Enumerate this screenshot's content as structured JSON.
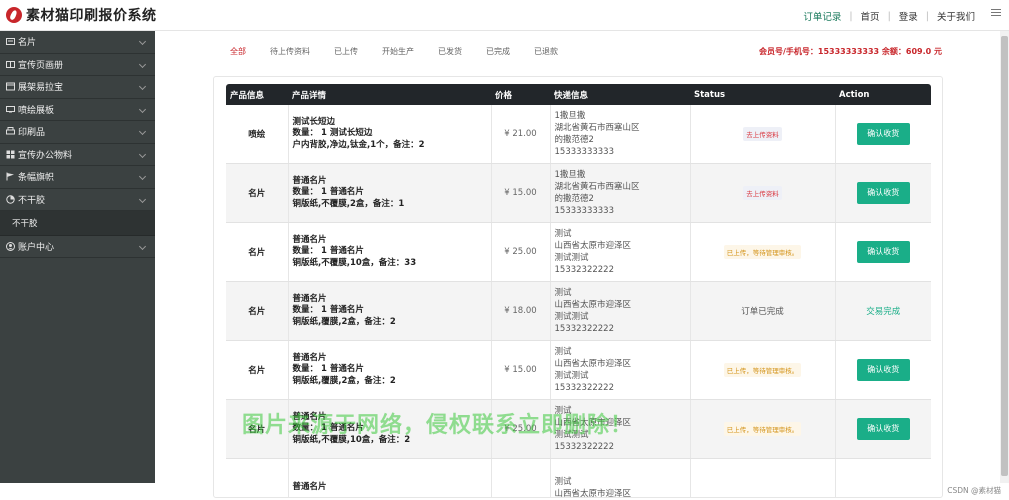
{
  "header": {
    "logo_text": "素材猫印刷报价系统",
    "nav": [
      "订单记录",
      "首页",
      "登录",
      "关于我们"
    ]
  },
  "sidebar": {
    "items": [
      {
        "label": "名片",
        "icon": "card-icon"
      },
      {
        "label": "宣传页画册",
        "icon": "book-icon"
      },
      {
        "label": "展架易拉宝",
        "icon": "display-icon"
      },
      {
        "label": "喷绘展板",
        "icon": "board-icon"
      },
      {
        "label": "印刷品",
        "icon": "printer-icon"
      },
      {
        "label": "宣传办公物料",
        "icon": "grid-icon"
      },
      {
        "label": "条幅旗帜",
        "icon": "flag-icon"
      },
      {
        "label": "不干胶",
        "icon": "sticker-icon"
      }
    ],
    "sub_item": "不干胶",
    "account": "账户中心"
  },
  "filters": [
    "全部",
    "待上传资料",
    "已上传",
    "开始生产",
    "已发货",
    "已完成",
    "已退款"
  ],
  "account_info": "会员号/手机号：15333333333 余额：609.0 元",
  "table": {
    "headers": [
      "产品信息",
      "产品详情",
      "价格",
      "快递信息",
      "Status",
      "Action"
    ],
    "rows": [
      {
        "cat": "喷绘",
        "d1": "测试长短边",
        "d2": "数量： 1 测试长短边",
        "d3": "户内背胶,净边,钛金,1个，备注：2",
        "price": "¥ 21.00",
        "s1": "1撒旦撒",
        "s2": "湖北省黄石市西塞山区",
        "s3": "的撒范德2",
        "s4": "15333333333",
        "status": "去上传资料",
        "status_type": "red",
        "action": "确认收货",
        "action_type": "button"
      },
      {
        "cat": "名片",
        "d1": "普通名片",
        "d2": "数量： 1 普通名片",
        "d3": "铜版纸,不覆膜,2盒，备注：1",
        "price": "¥ 15.00",
        "s1": "1撒旦撒",
        "s2": "湖北省黄石市西塞山区",
        "s3": "的撒范德2",
        "s4": "15333333333",
        "status": "去上传资料",
        "status_type": "red",
        "action": "确认收货",
        "action_type": "button"
      },
      {
        "cat": "名片",
        "d1": "普通名片",
        "d2": "数量： 1 普通名片",
        "d3": "铜版纸,不覆膜,10盒，备注：33",
        "price": "¥ 25.00",
        "s1": "测试",
        "s2": "山西省太原市迎泽区",
        "s3": "测试测试",
        "s4": "15332322222",
        "status": "已上传，等待管理审核。",
        "status_type": "yellow",
        "action": "确认收货",
        "action_type": "button"
      },
      {
        "cat": "名片",
        "d1": "普通名片",
        "d2": "数量： 1 普通名片",
        "d3": "铜版纸,覆膜,2盒，备注：2",
        "price": "¥ 18.00",
        "s1": "测试",
        "s2": "山西省太原市迎泽区",
        "s3": "测试测试",
        "s4": "15332322222",
        "status": "订单已完成",
        "status_type": "text",
        "action": "交易完成",
        "action_type": "link"
      },
      {
        "cat": "名片",
        "d1": "普通名片",
        "d2": "数量： 1 普通名片",
        "d3": "铜版纸,覆膜,2盒，备注：2",
        "price": "¥ 15.00",
        "s1": "测试",
        "s2": "山西省太原市迎泽区",
        "s3": "测试测试",
        "s4": "15332322222",
        "status": "已上传，等待管理审核。",
        "status_type": "yellow",
        "action": "确认收货",
        "action_type": "button"
      },
      {
        "cat": "名片",
        "d1": "普通名片",
        "d2": "数量： 1 普通名片",
        "d3": "铜版纸,不覆膜,10盒，备注：2",
        "price": "¥ 25.00",
        "s1": "测试",
        "s2": "山西省太原市迎泽区",
        "s3": "测试测试",
        "s4": "15332322222",
        "status": "已上传，等待管理审核。",
        "status_type": "yellow",
        "action": "确认收货",
        "action_type": "button"
      },
      {
        "cat": "",
        "d1": "普通名片",
        "d2": "",
        "d3": "",
        "price": "",
        "s1": "测试",
        "s2": "山西省太原市迎泽区",
        "s3": "",
        "s4": "",
        "status": "",
        "status_type": "text",
        "action": "",
        "action_type": "none"
      }
    ]
  },
  "watermark": "图片来源于网络，侵权联系立即删除！",
  "footer_credit": "CSDN @素材猫"
}
